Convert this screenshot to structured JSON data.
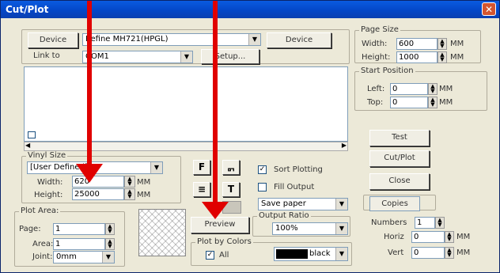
{
  "window": {
    "title": "Cut/Plot",
    "close_glyph": "✕"
  },
  "device": {
    "device_button": "Device",
    "device_combo": "Refine MH721(HPGL)",
    "device_button2": "Device",
    "link_label": "Link to",
    "link_combo": "COM1",
    "setup_button": "Setup..."
  },
  "page_size": {
    "title": "Page Size",
    "width_label": "Width:",
    "width_value": "600",
    "height_label": "Height:",
    "height_value": "1000",
    "unit": "MM"
  },
  "start_position": {
    "title": "Start Position",
    "left_label": "Left:",
    "left_value": "0",
    "top_label": "Top:",
    "top_value": "0",
    "unit": "MM"
  },
  "vinyl": {
    "title": "Vinyl Size",
    "combo": "[User Defined]",
    "width_label": "Width:",
    "width_value": "620",
    "height_label": "Height:",
    "height_value": "25000",
    "unit": "MM"
  },
  "plot_area": {
    "title": "Plot Area:",
    "page_label": "Page:",
    "page_value": "1",
    "area_label": "Area:",
    "area_value": "1",
    "joint_label": "Joint:",
    "joint_value": "0mm"
  },
  "options": {
    "sort_plotting": "Sort Plotting",
    "sort_checked": true,
    "fill_output": "Fill Output",
    "fill_checked": false,
    "save_paper": "Save paper",
    "output_ratio_title": "Output Ratio",
    "output_ratio_value": "100%",
    "preview_button": "Preview",
    "plot_by_colors_title": "Plot by Colors",
    "all_label": "All",
    "all_checked": true,
    "color_name": "black",
    "icon_f": "F",
    "icon_sym": "ᇚ",
    "icon_lines": "≡",
    "icon_t": "T"
  },
  "actions": {
    "test": "Test",
    "cutplot": "Cut/Plot",
    "close": "Close",
    "copies": "Copies",
    "numbers_label": "Numbers",
    "numbers_value": "1",
    "horiz_label": "Horiz",
    "horiz_value": "0",
    "vert_label": "Vert",
    "vert_value": "0",
    "unit": "MM"
  },
  "colors": {
    "title_bar": "#0a5be0",
    "annotation_arrow": "#e00000",
    "dialog_bg": "#ece9d8"
  }
}
